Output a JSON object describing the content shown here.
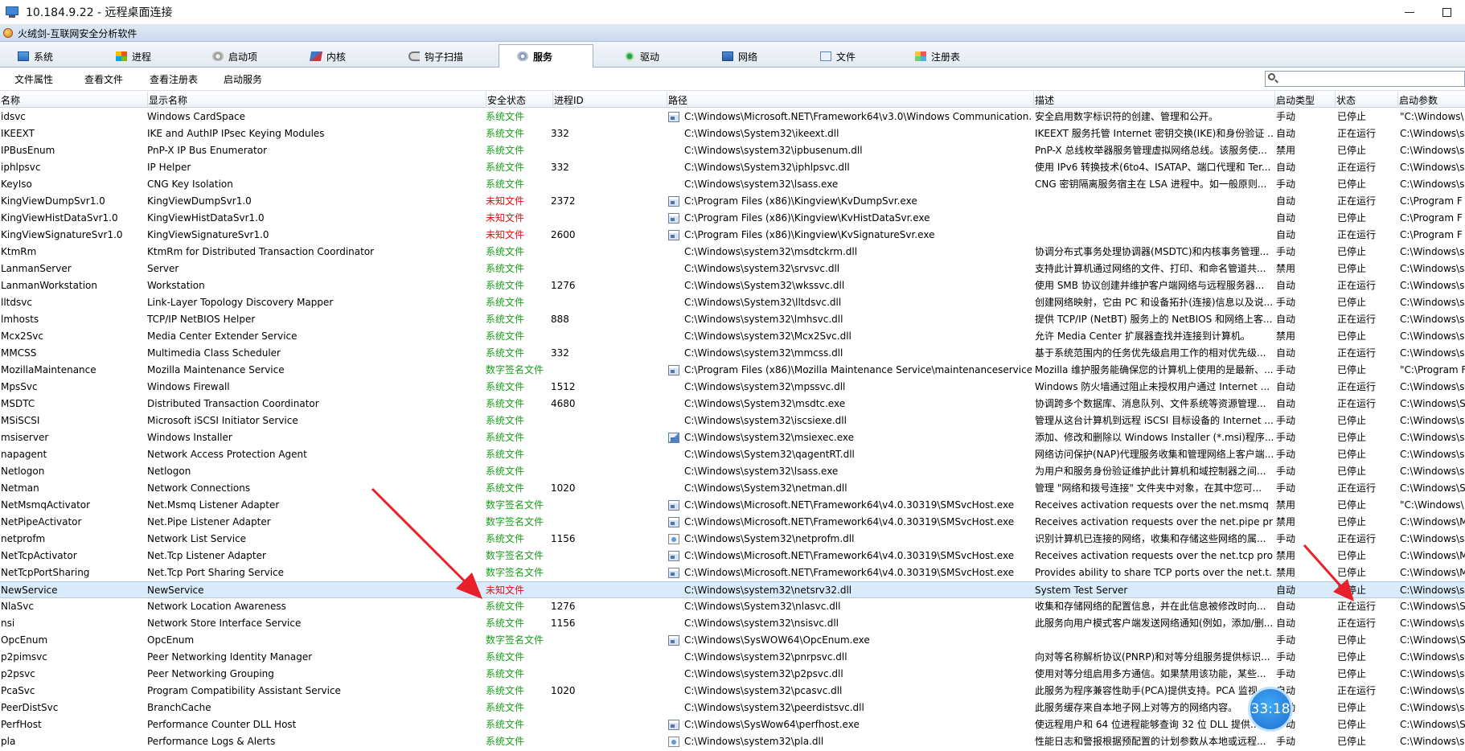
{
  "window": {
    "title": "10.184.9.22 - 远程桌面连接"
  },
  "app": {
    "title": "火绒剑-互联网安全分析软件"
  },
  "tabs": [
    {
      "label": "系统",
      "icon": "system-icon"
    },
    {
      "label": "进程",
      "icon": "process-icon"
    },
    {
      "label": "启动项",
      "icon": "startup-icon"
    },
    {
      "label": "内核",
      "icon": "kernel-icon"
    },
    {
      "label": "钩子扫描",
      "icon": "hook-icon"
    },
    {
      "label": "服务",
      "icon": "service-icon",
      "active": true
    },
    {
      "label": "驱动",
      "icon": "driver-icon"
    },
    {
      "label": "网络",
      "icon": "network-icon"
    },
    {
      "label": "文件",
      "icon": "file-icon"
    },
    {
      "label": "注册表",
      "icon": "registry-icon"
    }
  ],
  "toolbar": {
    "file_props": "文件属性",
    "view_file": "查看文件",
    "view_registry": "查看注册表",
    "start_service": "启动服务",
    "search_placeholder": ""
  },
  "columns": [
    "名称",
    "显示名称",
    "安全状态",
    "进程ID",
    "路径",
    "描述",
    "启动类型",
    "状态",
    "启动参数"
  ],
  "colors": {
    "green": "#1a9e1a",
    "red": "#e01010",
    "selected_row": "#d9ebfb",
    "arrow": "#e8202a"
  },
  "rows": [
    {
      "name": "idsvc",
      "display": "Windows CardSpace",
      "security": "系统文件",
      "sec_type": "green",
      "pid": "",
      "icon": "exe",
      "path": "C:\\Windows\\Microsoft.NET\\Framework64\\v3.0\\Windows Communication...",
      "desc": "安全启用数字标识符的创建、管理和公开。",
      "start": "手动",
      "status": "已停止",
      "params": "\"C:\\Windows\\"
    },
    {
      "name": "IKEEXT",
      "display": "IKE and AuthIP IPsec Keying Modules",
      "security": "系统文件",
      "sec_type": "green",
      "pid": "332",
      "icon": "",
      "path": "C:\\Windows\\System32\\ikeext.dll",
      "desc": "IKEEXT 服务托管 Internet 密钥交换(IKE)和身份验证 ...",
      "start": "自动",
      "status": "正在运行",
      "params": "C:\\Windows\\s"
    },
    {
      "name": "IPBusEnum",
      "display": "PnP-X IP Bus Enumerator",
      "security": "系统文件",
      "sec_type": "green",
      "pid": "",
      "icon": "",
      "path": "C:\\Windows\\system32\\ipbusenum.dll",
      "desc": "PnP-X 总线枚举器服务管理虚拟网络总线。该服务使...",
      "start": "禁用",
      "status": "已停止",
      "params": "C:\\Windows\\s"
    },
    {
      "name": "iphlpsvc",
      "display": "IP Helper",
      "security": "系统文件",
      "sec_type": "green",
      "pid": "332",
      "icon": "",
      "path": "C:\\Windows\\System32\\iphlpsvc.dll",
      "desc": "使用 IPv6 转换技术(6to4、ISATAP、端口代理和 Ter...",
      "start": "自动",
      "status": "正在运行",
      "params": "C:\\Windows\\s"
    },
    {
      "name": "KeyIso",
      "display": "CNG Key Isolation",
      "security": "系统文件",
      "sec_type": "green",
      "pid": "",
      "icon": "",
      "path": "C:\\Windows\\system32\\lsass.exe",
      "desc": "CNG 密钥隔离服务宿主在 LSA 进程中。如一般原则...",
      "start": "手动",
      "status": "已停止",
      "params": "C:\\Windows\\s"
    },
    {
      "name": "KingViewDumpSvr1.0",
      "display": "KingViewDumpSvr1.0",
      "security": "未知文件",
      "sec_type": "red",
      "pid": "2372",
      "icon": "exe",
      "path": "C:\\Program Files (x86)\\Kingview\\KvDumpSvr.exe",
      "desc": "",
      "start": "自动",
      "status": "正在运行",
      "params": "C:\\Program F"
    },
    {
      "name": "KingViewHistDataSvr1.0",
      "display": "KingViewHistDataSvr1.0",
      "security": "未知文件",
      "sec_type": "red",
      "pid": "",
      "icon": "exe",
      "path": "C:\\Program Files (x86)\\Kingview\\KvHistDataSvr.exe",
      "desc": "",
      "start": "自动",
      "status": "已停止",
      "params": "C:\\Program F"
    },
    {
      "name": "KingViewSignatureSvr1.0",
      "display": "KingViewSignatureSvr1.0",
      "security": "未知文件",
      "sec_type": "red",
      "pid": "2600",
      "icon": "exe",
      "path": "C:\\Program Files (x86)\\Kingview\\KvSignatureSvr.exe",
      "desc": "",
      "start": "自动",
      "status": "正在运行",
      "params": "C:\\Program F"
    },
    {
      "name": "KtmRm",
      "display": "KtmRm for Distributed Transaction Coordinator",
      "security": "系统文件",
      "sec_type": "green",
      "pid": "",
      "icon": "",
      "path": "C:\\Windows\\system32\\msdtckrm.dll",
      "desc": "协调分布式事务处理协调器(MSDTC)和内核事务管理...",
      "start": "手动",
      "status": "已停止",
      "params": "C:\\Windows\\s"
    },
    {
      "name": "LanmanServer",
      "display": "Server",
      "security": "系统文件",
      "sec_type": "green",
      "pid": "",
      "icon": "",
      "path": "C:\\Windows\\system32\\srvsvc.dll",
      "desc": "支持此计算机通过网络的文件、打印、和命名管道共...",
      "start": "禁用",
      "status": "已停止",
      "params": "C:\\Windows\\s"
    },
    {
      "name": "LanmanWorkstation",
      "display": "Workstation",
      "security": "系统文件",
      "sec_type": "green",
      "pid": "1276",
      "icon": "",
      "path": "C:\\Windows\\System32\\wkssvc.dll",
      "desc": "使用 SMB 协议创建并维护客户端网络与远程服务器...",
      "start": "自动",
      "status": "正在运行",
      "params": "C:\\Windows\\s"
    },
    {
      "name": "lltdsvc",
      "display": "Link-Layer Topology Discovery Mapper",
      "security": "系统文件",
      "sec_type": "green",
      "pid": "",
      "icon": "",
      "path": "C:\\Windows\\System32\\lltdsvc.dll",
      "desc": "创建网络映射，它由 PC 和设备拓扑(连接)信息以及说...",
      "start": "手动",
      "status": "已停止",
      "params": "C:\\Windows\\s"
    },
    {
      "name": "lmhosts",
      "display": "TCP/IP NetBIOS Helper",
      "security": "系统文件",
      "sec_type": "green",
      "pid": "888",
      "icon": "",
      "path": "C:\\Windows\\system32\\lmhsvc.dll",
      "desc": "提供 TCP/IP (NetBT) 服务上的 NetBIOS 和网络上客...",
      "start": "自动",
      "status": "正在运行",
      "params": "C:\\Windows\\s"
    },
    {
      "name": "Mcx2Svc",
      "display": "Media Center Extender Service",
      "security": "系统文件",
      "sec_type": "green",
      "pid": "",
      "icon": "",
      "path": "C:\\Windows\\system32\\Mcx2Svc.dll",
      "desc": "允许 Media Center 扩展器查找并连接到计算机。",
      "start": "禁用",
      "status": "已停止",
      "params": "C:\\Windows\\s"
    },
    {
      "name": "MMCSS",
      "display": "Multimedia Class Scheduler",
      "security": "系统文件",
      "sec_type": "green",
      "pid": "332",
      "icon": "",
      "path": "C:\\Windows\\system32\\mmcss.dll",
      "desc": "基于系统范围内的任务优先级启用工作的相对优先级...",
      "start": "自动",
      "status": "正在运行",
      "params": "C:\\Windows\\s"
    },
    {
      "name": "MozillaMaintenance",
      "display": "Mozilla Maintenance Service",
      "security": "数字签名文件",
      "sec_type": "signed",
      "pid": "",
      "icon": "exe",
      "path": "C:\\Program Files (x86)\\Mozilla Maintenance Service\\maintenanceservice...",
      "desc": "Mozilla 维护服务能确保您的计算机上使用的是最新、...",
      "start": "手动",
      "status": "已停止",
      "params": "\"C:\\Program F"
    },
    {
      "name": "MpsSvc",
      "display": "Windows Firewall",
      "security": "系统文件",
      "sec_type": "green",
      "pid": "1512",
      "icon": "",
      "path": "C:\\Windows\\system32\\mpssvc.dll",
      "desc": "Windows 防火墙通过阻止未授权用户通过 Internet ...",
      "start": "自动",
      "status": "正在运行",
      "params": "C:\\Windows\\s"
    },
    {
      "name": "MSDTC",
      "display": "Distributed Transaction Coordinator",
      "security": "系统文件",
      "sec_type": "green",
      "pid": "4680",
      "icon": "",
      "path": "C:\\Windows\\System32\\msdtc.exe",
      "desc": "协调跨多个数据库、消息队列、文件系统等资源管理...",
      "start": "自动",
      "status": "正在运行",
      "params": "C:\\Windows\\S"
    },
    {
      "name": "MSiSCSI",
      "display": "Microsoft iSCSI Initiator Service",
      "security": "系统文件",
      "sec_type": "green",
      "pid": "",
      "icon": "",
      "path": "C:\\Windows\\system32\\iscsiexe.dll",
      "desc": "管理从这台计算机到远程 iSCSI 目标设备的 Internet ...",
      "start": "手动",
      "status": "已停止",
      "params": "C:\\Windows\\s"
    },
    {
      "name": "msiserver",
      "display": "Windows Installer",
      "security": "系统文件",
      "sec_type": "green",
      "pid": "",
      "icon": "msi",
      "path": "C:\\Windows\\system32\\msiexec.exe",
      "desc": "添加、修改和删除以 Windows Installer (*.msi)程序...",
      "start": "手动",
      "status": "已停止",
      "params": "C:\\Windows\\s"
    },
    {
      "name": "napagent",
      "display": "Network Access Protection Agent",
      "security": "系统文件",
      "sec_type": "green",
      "pid": "",
      "icon": "",
      "path": "C:\\Windows\\System32\\qagentRT.dll",
      "desc": "网络访问保护(NAP)代理服务收集和管理网络上客户端...",
      "start": "手动",
      "status": "已停止",
      "params": "C:\\Windows\\s"
    },
    {
      "name": "Netlogon",
      "display": "Netlogon",
      "security": "系统文件",
      "sec_type": "green",
      "pid": "",
      "icon": "",
      "path": "C:\\Windows\\system32\\lsass.exe",
      "desc": "为用户和服务身份验证维护此计算机和域控制器之间...",
      "start": "手动",
      "status": "已停止",
      "params": "C:\\Windows\\s"
    },
    {
      "name": "Netman",
      "display": "Network Connections",
      "security": "系统文件",
      "sec_type": "green",
      "pid": "1020",
      "icon": "",
      "path": "C:\\Windows\\System32\\netman.dll",
      "desc": "管理 \"网络和拨号连接\" 文件夹中对象，在其中您可...",
      "start": "手动",
      "status": "正在运行",
      "params": "C:\\Windows\\S"
    },
    {
      "name": "NetMsmqActivator",
      "display": "Net.Msmq Listener Adapter",
      "security": "数字签名文件",
      "sec_type": "signed",
      "pid": "",
      "icon": "exe",
      "path": "C:\\Windows\\Microsoft.NET\\Framework64\\v4.0.30319\\SMSvcHost.exe",
      "desc": "Receives activation requests over the net.msmq ...",
      "start": "禁用",
      "status": "已停止",
      "params": "\"C:\\Windows\\"
    },
    {
      "name": "NetPipeActivator",
      "display": "Net.Pipe Listener Adapter",
      "security": "数字签名文件",
      "sec_type": "signed",
      "pid": "",
      "icon": "exe",
      "path": "C:\\Windows\\Microsoft.NET\\Framework64\\v4.0.30319\\SMSvcHost.exe",
      "desc": "Receives activation requests over the net.pipe pr...",
      "start": "禁用",
      "status": "已停止",
      "params": "C:\\Windows\\M"
    },
    {
      "name": "netprofm",
      "display": "Network List Service",
      "security": "系统文件",
      "sec_type": "green",
      "pid": "1156",
      "icon": "cert",
      "path": "C:\\Windows\\System32\\netprofm.dll",
      "desc": "识别计算机已连接的网络，收集和存储这些网络的属...",
      "start": "手动",
      "status": "正在运行",
      "params": "C:\\Windows\\s"
    },
    {
      "name": "NetTcpActivator",
      "display": "Net.Tcp Listener Adapter",
      "security": "数字签名文件",
      "sec_type": "signed",
      "pid": "",
      "icon": "exe",
      "path": "C:\\Windows\\Microsoft.NET\\Framework64\\v4.0.30319\\SMSvcHost.exe",
      "desc": "Receives activation requests over the net.tcp pro...",
      "start": "禁用",
      "status": "已停止",
      "params": "C:\\Windows\\M"
    },
    {
      "name": "NetTcpPortSharing",
      "display": "Net.Tcp Port Sharing Service",
      "security": "数字签名文件",
      "sec_type": "signed",
      "pid": "",
      "icon": "exe",
      "path": "C:\\Windows\\Microsoft.NET\\Framework64\\v4.0.30319\\SMSvcHost.exe",
      "desc": "Provides ability to share TCP ports over the net.t...",
      "start": "禁用",
      "status": "已停止",
      "params": "C:\\Windows\\M"
    },
    {
      "name": "NewService",
      "display": "NewService",
      "security": "未知文件",
      "sec_type": "red",
      "pid": "",
      "icon": "",
      "path": "C:\\Windows\\system32\\netsrv32.dll",
      "desc": "System Test Server",
      "start": "自动",
      "status": "已停止",
      "params": "C:\\Windows\\s",
      "selected": true
    },
    {
      "name": "NlaSvc",
      "display": "Network Location Awareness",
      "security": "系统文件",
      "sec_type": "green",
      "pid": "1276",
      "icon": "",
      "path": "C:\\Windows\\System32\\nlasvc.dll",
      "desc": "收集和存储网络的配置信息，并在此信息被修改时向...",
      "start": "自动",
      "status": "正在运行",
      "params": "C:\\Windows\\S"
    },
    {
      "name": "nsi",
      "display": "Network Store Interface Service",
      "security": "系统文件",
      "sec_type": "green",
      "pid": "1156",
      "icon": "",
      "path": "C:\\Windows\\system32\\nsisvc.dll",
      "desc": "此服务向用户模式客户端发送网络通知(例如，添加/删...",
      "start": "自动",
      "status": "正在运行",
      "params": "C:\\Windows\\s"
    },
    {
      "name": "OpcEnum",
      "display": "OpcEnum",
      "security": "数字签名文件",
      "sec_type": "signed",
      "pid": "",
      "icon": "exe",
      "path": "C:\\Windows\\SysWOW64\\OpcEnum.exe",
      "desc": "",
      "start": "手动",
      "status": "已停止",
      "params": "C:\\Windows\\S"
    },
    {
      "name": "p2pimsvc",
      "display": "Peer Networking Identity Manager",
      "security": "系统文件",
      "sec_type": "green",
      "pid": "",
      "icon": "",
      "path": "C:\\Windows\\system32\\pnrpsvc.dll",
      "desc": "向对等名称解析协议(PNRP)和对等分组服务提供标识...",
      "start": "手动",
      "status": "已停止",
      "params": "C:\\Windows\\s"
    },
    {
      "name": "p2psvc",
      "display": "Peer Networking Grouping",
      "security": "系统文件",
      "sec_type": "green",
      "pid": "",
      "icon": "",
      "path": "C:\\Windows\\system32\\p2psvc.dll",
      "desc": "使用对等分组启用多方通信。如果禁用该功能，某些...",
      "start": "手动",
      "status": "已停止",
      "params": "C:\\Windows\\s"
    },
    {
      "name": "PcaSvc",
      "display": "Program Compatibility Assistant Service",
      "security": "系统文件",
      "sec_type": "green",
      "pid": "1020",
      "icon": "",
      "path": "C:\\Windows\\system32\\pcasvc.dll",
      "desc": "此服务为程序兼容性助手(PCA)提供支持。PCA 监视...",
      "start": "自动",
      "status": "正在运行",
      "params": "C:\\Windows\\s"
    },
    {
      "name": "PeerDistSvc",
      "display": "BranchCache",
      "security": "系统文件",
      "sec_type": "green",
      "pid": "",
      "icon": "",
      "path": "C:\\Windows\\system32\\peerdistsvc.dll",
      "desc": "此服务缓存来自本地子网上对等方的网络内容。",
      "start": "手动",
      "status": "已停止",
      "params": "C:\\Windows\\s"
    },
    {
      "name": "PerfHost",
      "display": "Performance Counter DLL Host",
      "security": "系统文件",
      "sec_type": "green",
      "pid": "",
      "icon": "exe",
      "path": "C:\\Windows\\SysWow64\\perfhost.exe",
      "desc": "使远程用户和 64 位进程能够查询 32 位 DLL 提供...",
      "start": "手动",
      "status": "已停止",
      "params": "C:\\Windows\\S"
    },
    {
      "name": "pla",
      "display": "Performance Logs & Alerts",
      "security": "系统文件",
      "sec_type": "green",
      "pid": "",
      "icon": "cert",
      "path": "C:\\Windows\\system32\\pla.dll",
      "desc": "性能日志和警报根据预配置的计划参数从本地或远程...",
      "start": "手动",
      "status": "已停止",
      "params": "C:\\Windows\\s"
    }
  ],
  "clock_badge": "33:18"
}
